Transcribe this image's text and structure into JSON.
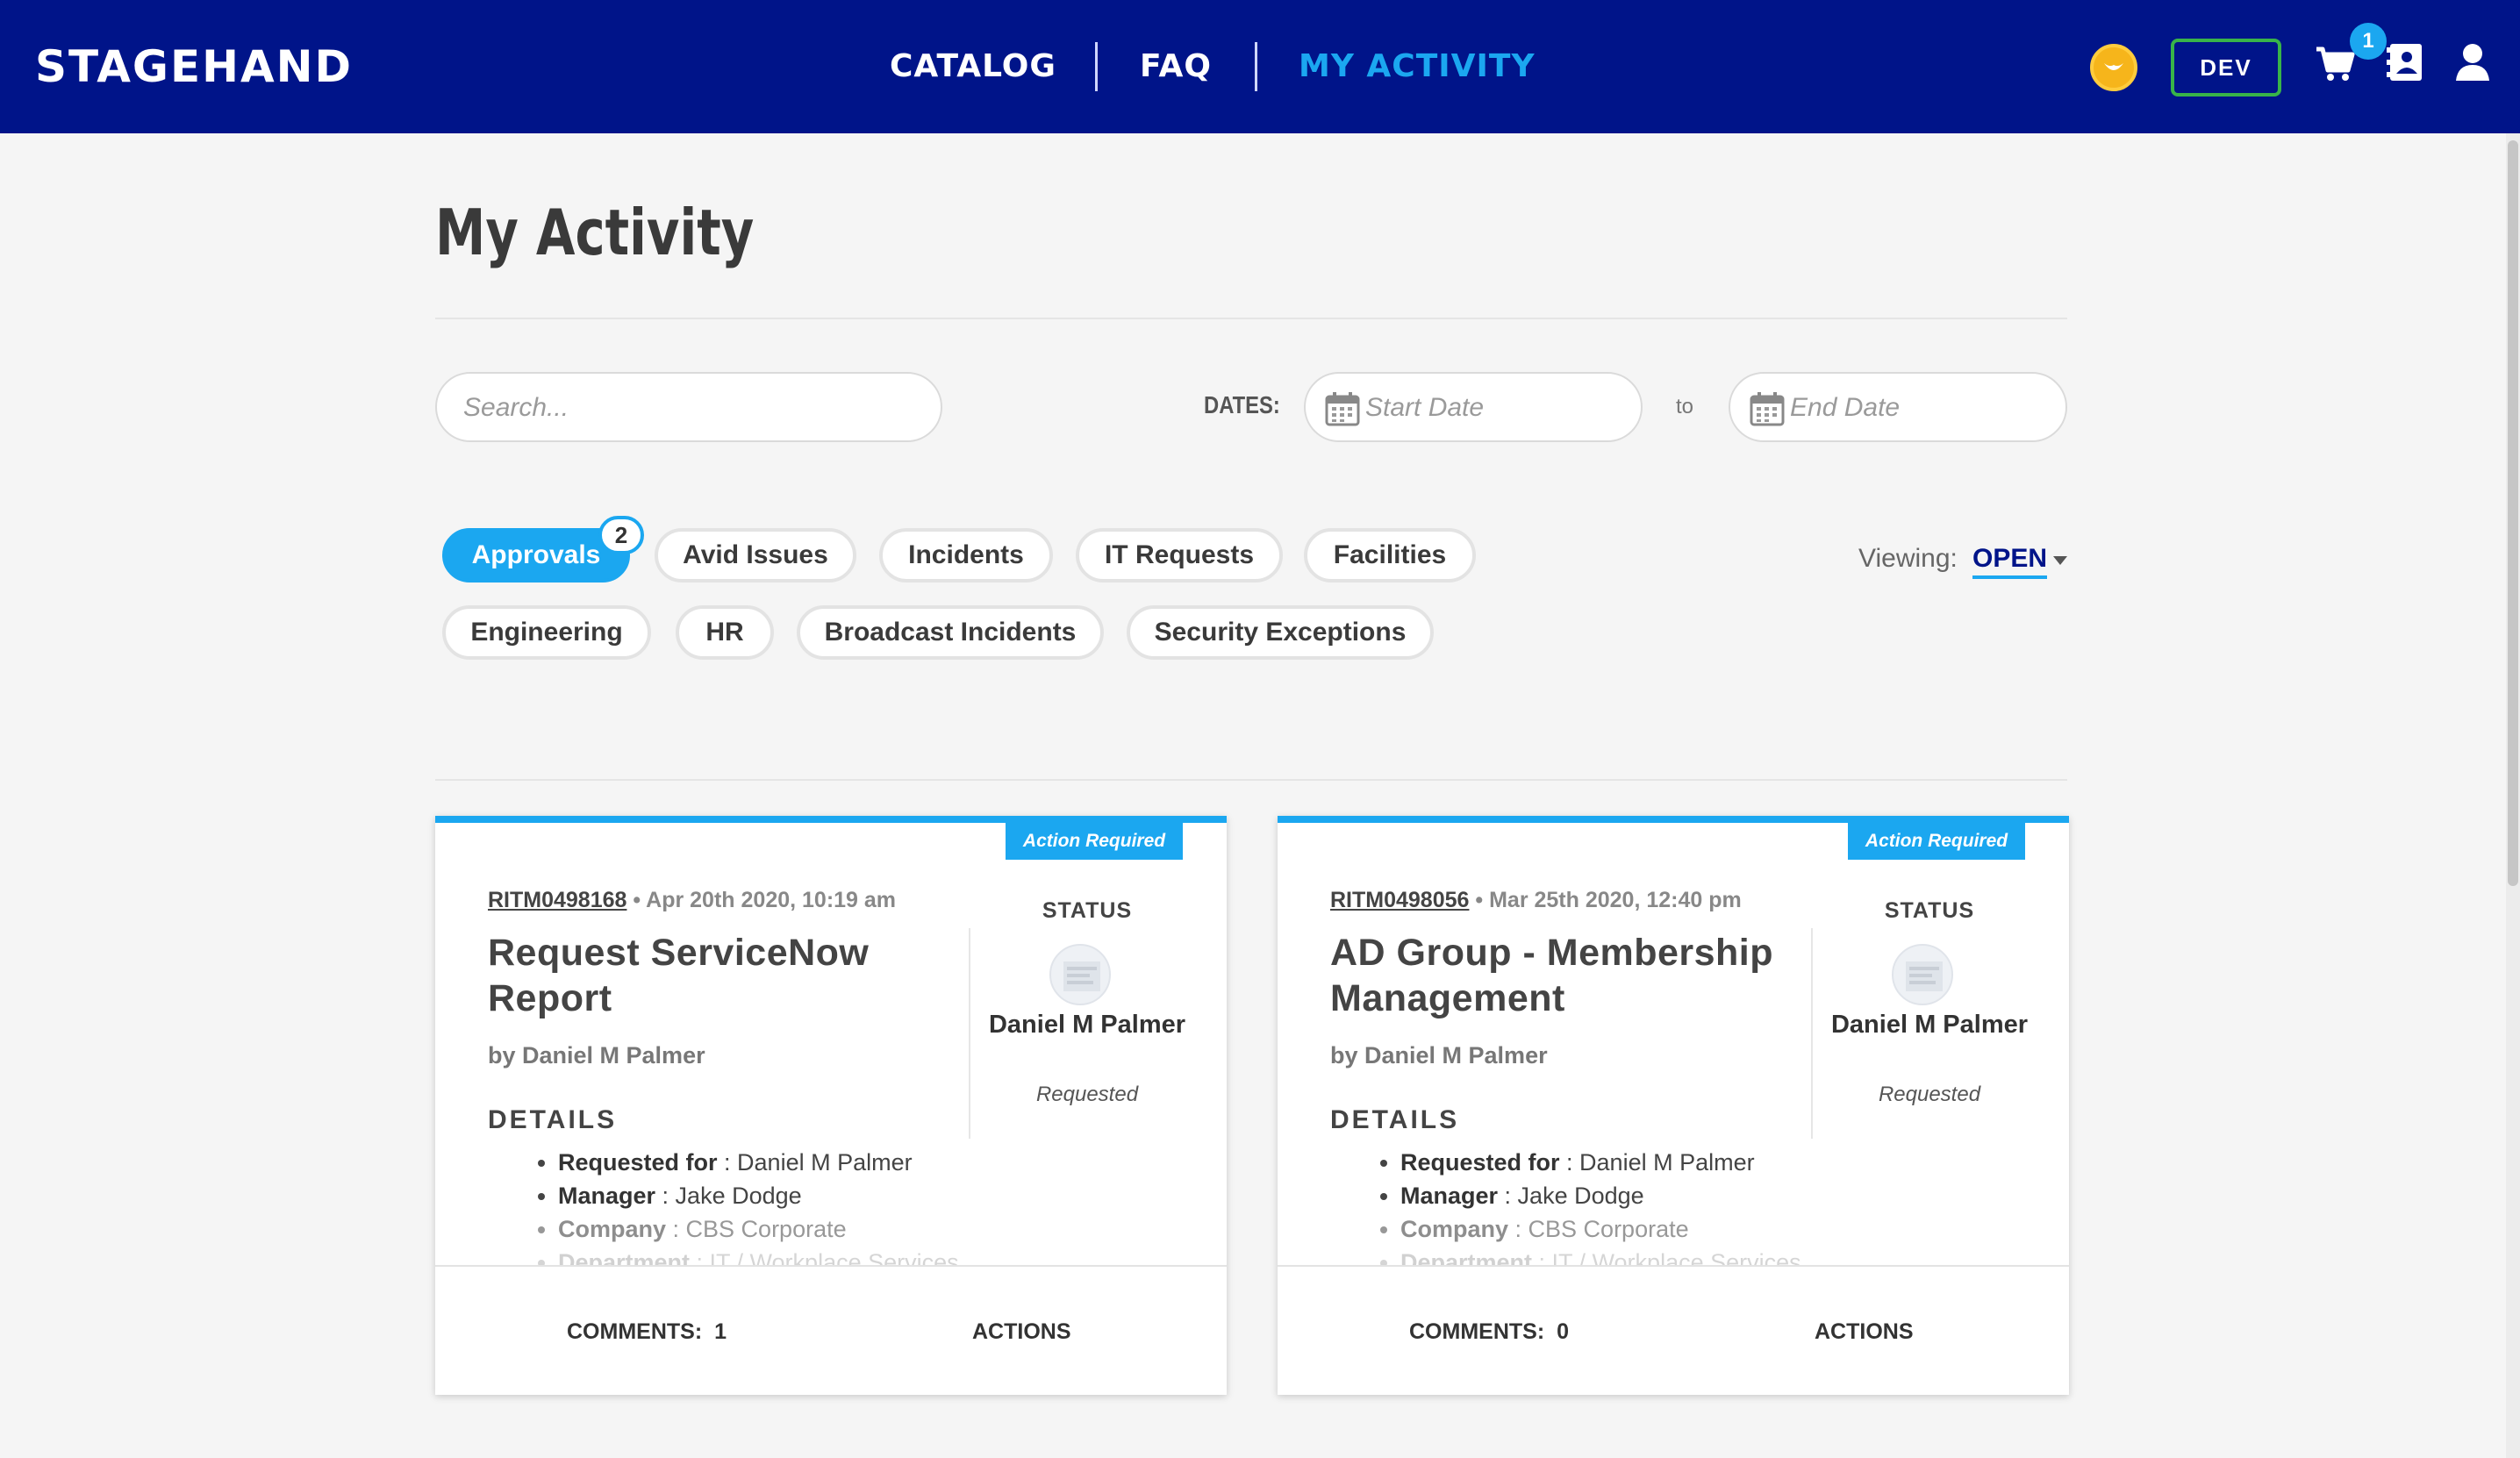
{
  "header": {
    "logo": "STAGEHAND",
    "nav": [
      {
        "label": "CATALOG"
      },
      {
        "label": "FAQ"
      },
      {
        "label": "MY ACTIVITY"
      }
    ],
    "env_label": "DEV",
    "cart_count": "1",
    "colors": {
      "bar": "#001489",
      "accent": "#1ba7f0",
      "env_border": "#38b449"
    }
  },
  "page": {
    "title": "My Activity",
    "search_placeholder": "Search...",
    "dates_label": "DATES:",
    "start_placeholder": "Start Date",
    "to_label": "to",
    "end_placeholder": "End Date",
    "viewing_label": "Viewing:",
    "viewing_value": "OPEN"
  },
  "tabs": [
    {
      "label": "Approvals",
      "active": true,
      "badge": "2"
    },
    {
      "label": "Avid Issues"
    },
    {
      "label": "Incidents"
    },
    {
      "label": "IT Requests"
    },
    {
      "label": "Facilities"
    },
    {
      "label": "Engineering"
    },
    {
      "label": "HR"
    },
    {
      "label": "Broadcast Incidents"
    },
    {
      "label": "Security Exceptions"
    }
  ],
  "cards": [
    {
      "flag": "Action Required",
      "number": "RITM0498168",
      "date": "Apr 20th 2020, 10:19 am",
      "title": "Request ServiceNow Report",
      "by": "by Daniel M Palmer",
      "details_heading": "DETAILS",
      "details": [
        {
          "key": "Requested for",
          "value": " : Daniel M Palmer"
        },
        {
          "key": "Manager",
          "value": " : Jake Dodge"
        },
        {
          "key": "Company",
          "value": " : CBS Corporate"
        },
        {
          "key": "Department",
          "value": " : IT / Workplace Services"
        }
      ],
      "status_heading": "STATUS",
      "status_name": "Daniel M Palmer",
      "status_sub": "Requested",
      "comments_label": "COMMENTS:",
      "comments_count": "1",
      "actions_label": "ACTIONS"
    },
    {
      "flag": "Action Required",
      "number": "RITM0498056",
      "date": "Mar 25th 2020, 12:40 pm",
      "title": "AD Group - Membership Management",
      "by": "by Daniel M Palmer",
      "details_heading": "DETAILS",
      "details": [
        {
          "key": "Requested for",
          "value": " : Daniel M Palmer"
        },
        {
          "key": "Manager",
          "value": " : Jake Dodge"
        },
        {
          "key": "Company",
          "value": " : CBS Corporate"
        },
        {
          "key": "Department",
          "value": " : IT / Workplace Services"
        }
      ],
      "status_heading": "STATUS",
      "status_name": "Daniel M Palmer",
      "status_sub": "Requested",
      "comments_label": "COMMENTS:",
      "comments_count": "0",
      "actions_label": "ACTIONS"
    }
  ]
}
